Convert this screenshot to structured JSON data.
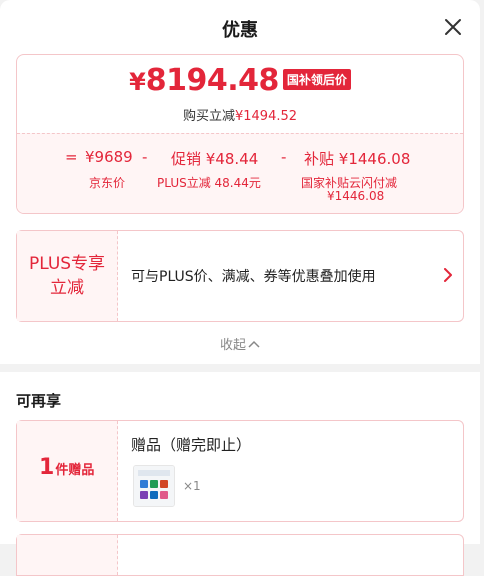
{
  "header": {
    "title": "优惠"
  },
  "price": {
    "currency": "¥",
    "final": "8194.48",
    "badge": "国补领后价",
    "saving_label": "购买立减",
    "saving_value": "¥1494.52"
  },
  "breakdown": {
    "eq": "=",
    "minus": "-",
    "jd_price": "¥9689",
    "jd_label": "京东价",
    "promo_label": "促销",
    "promo_value": "¥48.44",
    "promo_desc": "PLUS立减 48.44元",
    "subsidy_label": "补贴",
    "subsidy_value": "¥1446.08",
    "subsidy_desc_1": "国家补贴云闪付减",
    "subsidy_desc_2": "¥1446.08"
  },
  "plus": {
    "line1": "PLUS专享",
    "line2": "立减",
    "desc": "可与PLUS价、满减、券等优惠叠加使用"
  },
  "collapse_label": "收起",
  "extra": {
    "title": "可再享",
    "gift_count": "1",
    "gift_unit": "件赠品",
    "gift_title": "赠品（赠完即止）",
    "gift_qty": "×1"
  },
  "colors": {
    "accent": "#e3263a",
    "tint": "#fff5f5",
    "border": "#f4c6c9"
  },
  "icons": [
    "close-icon",
    "chevron-right-icon",
    "chevron-up-icon",
    "gift-thumbnail"
  ]
}
